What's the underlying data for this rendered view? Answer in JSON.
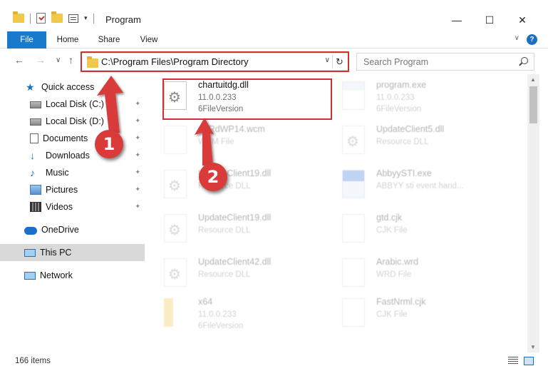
{
  "window": {
    "title": "Program",
    "minimize_glyph": "—",
    "maximize_glyph": "☐",
    "close_glyph": "✕"
  },
  "ribbon": {
    "tabs": [
      {
        "label": "File"
      },
      {
        "label": "Home"
      },
      {
        "label": "Share"
      },
      {
        "label": "View"
      }
    ],
    "help_glyph": "?",
    "collapse_glyph": "∨"
  },
  "navigation": {
    "back_glyph": "←",
    "forward_glyph": "→",
    "recent_glyph": "∨",
    "up_glyph": "↑"
  },
  "address_bar": {
    "path": "C:\\Program Files\\Program Directory",
    "dropdown_glyph": "∨",
    "refresh_glyph": "↻"
  },
  "search": {
    "placeholder": "Search Program"
  },
  "nav_pane": {
    "quick_access": "Quick access",
    "items": [
      {
        "label": "Local Disk (C:)",
        "icon": "drive-icon",
        "pinned": true
      },
      {
        "label": "Local Disk (D:)",
        "icon": "drive-icon",
        "pinned": true
      },
      {
        "label": "Documents",
        "icon": "documents-icon",
        "pinned": true
      },
      {
        "label": "Downloads",
        "icon": "downloads-icon",
        "pinned": true
      },
      {
        "label": "Music",
        "icon": "music-icon",
        "pinned": true
      },
      {
        "label": "Pictures",
        "icon": "pictures-icon",
        "pinned": true
      },
      {
        "label": "Videos",
        "icon": "videos-icon",
        "pinned": true
      }
    ],
    "onedrive": "OneDrive",
    "this_pc": "This PC",
    "network": "Network",
    "pin_glyph": "📌"
  },
  "files": [
    {
      "name": "chartuitdg.dll",
      "meta1": "11.0.0.233",
      "meta2": "6FileVersion",
      "icon": "dll-file-icon",
      "highlighted": true
    },
    {
      "name": "program.exe",
      "meta1": "11.0.0.233",
      "meta2": "6FileVersion",
      "icon": "exe-file-icon",
      "highlighted": false
    },
    {
      "name": "AcRdWP14.wcm",
      "meta1": "WCM File",
      "meta2": "",
      "icon": "generic-file-icon",
      "highlighted": false
    },
    {
      "name": "UpdateClient5.dll",
      "meta1": "Resource DLL",
      "meta2": "",
      "icon": "dll-file-icon",
      "highlighted": false
    },
    {
      "name": "UpdateClient19.dll",
      "meta1": "Resource DLL",
      "meta2": "",
      "icon": "dll-file-icon",
      "highlighted": false
    },
    {
      "name": "AbbyySTI.exe",
      "meta1": "ABBYY sti event hand...",
      "meta2": "",
      "icon": "exe-file-icon",
      "highlighted": false
    },
    {
      "name": "UpdateClient19.dll",
      "meta1": "Resource DLL",
      "meta2": "",
      "icon": "dll-file-icon",
      "highlighted": false
    },
    {
      "name": "gtd.cjk",
      "meta1": "CJK File",
      "meta2": "",
      "icon": "generic-file-icon",
      "highlighted": false
    },
    {
      "name": "UpdateClient42.dll",
      "meta1": "Resource DLL",
      "meta2": "",
      "icon": "dll-file-icon",
      "highlighted": false
    },
    {
      "name": "Arabic.wrd",
      "meta1": "WRD File",
      "meta2": "",
      "icon": "generic-file-icon",
      "highlighted": false
    },
    {
      "name": "x64",
      "meta1": "11.0.0.233",
      "meta2": "6FileVersion",
      "icon": "folder-icon",
      "highlighted": false
    },
    {
      "name": "FastNrml.cjk",
      "meta1": "CJK File",
      "meta2": "",
      "icon": "generic-file-icon",
      "highlighted": false
    }
  ],
  "status": {
    "item_count": "166 items"
  },
  "callouts": [
    {
      "number": "1"
    },
    {
      "number": "2"
    }
  ],
  "colors": {
    "accent": "#1979ca",
    "highlight_frame": "#d32f2f",
    "callout": "#d93a3a"
  }
}
